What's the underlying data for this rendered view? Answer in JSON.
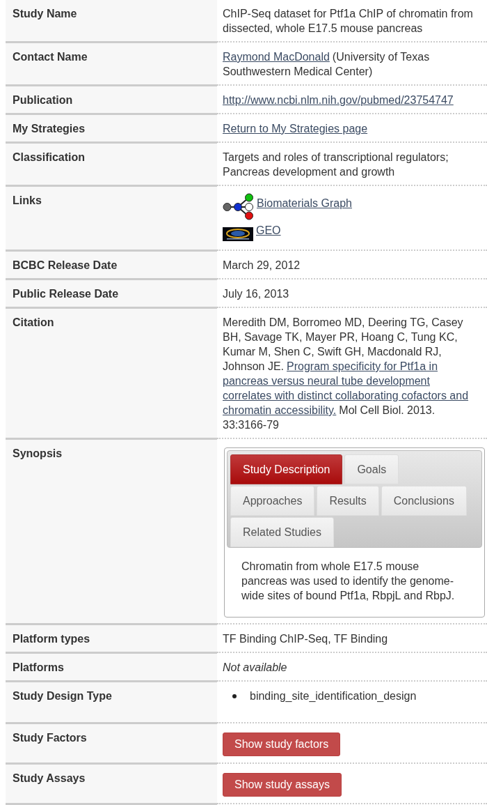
{
  "rows": [
    {
      "label": "Study Name",
      "kind": "text",
      "value": "ChIP-Seq dataset for Ptf1a ChIP of chromatin from dissected, whole E17.5 mouse pancreas"
    },
    {
      "label": "Contact Name",
      "kind": "lines",
      "lines": [
        [
          {
            "kind": "link",
            "text": "Raymond MacDonald"
          },
          {
            "kind": "text",
            "text": "(University of Texas"
          }
        ],
        [
          {
            "kind": "text",
            "text": "Southwestern Medical Center)"
          }
        ]
      ]
    },
    {
      "label": "Publication",
      "kind": "lines",
      "lines": [
        [
          {
            "kind": "link",
            "text": "http://www.ncbi.nlm.nih.gov/pubmed/23754747"
          }
        ]
      ]
    },
    {
      "label": "My Strategies",
      "kind": "lines",
      "lines": [
        [
          {
            "kind": "link",
            "text": "Return to My Strategies page"
          }
        ]
      ]
    },
    {
      "label": "Classification",
      "kind": "text",
      "value": "Targets and roles of transcriptional regulators; Pancreas development and growth"
    },
    {
      "label": "Links",
      "kind": "links",
      "links": [
        {
          "kind": "graph",
          "text": "Biomaterials Graph"
        },
        {
          "kind": "geo",
          "text": "GEO"
        }
      ]
    },
    {
      "label": "BCBC Release Date",
      "kind": "text",
      "value": "March 29, 2012"
    },
    {
      "label": "Public Release Date",
      "kind": "text",
      "value": "July 16, 2013"
    },
    {
      "label": "Citation",
      "kind": "lines",
      "lines": [
        [
          {
            "kind": "text",
            "text": "Meredith DM, Borromeo MD, Deering TG, Casey"
          }
        ],
        [
          {
            "kind": "text",
            "text": "BH, Savage TK, Mayer PR, Hoang C, Tung KC,"
          }
        ],
        [
          {
            "kind": "text",
            "text": "Kumar M, Shen C, Swift GH, Macdonald RJ,"
          }
        ],
        [
          {
            "kind": "text",
            "text": "Johnson JE."
          },
          {
            "kind": "link",
            "text": "Program specificity for Ptf1a in"
          }
        ],
        [
          {
            "kind": "link",
            "text": "pancreas versus neural tube development"
          }
        ],
        [
          {
            "kind": "link",
            "text": "correlates with distinct collaborating cofactors and"
          }
        ],
        [
          {
            "kind": "link",
            "text": "chromatin accessibility."
          },
          {
            "kind": "text",
            "text": "Mol Cell Biol. 2013."
          }
        ],
        [
          {
            "kind": "text",
            "text": "33:3166-79"
          }
        ]
      ]
    },
    {
      "label": "Synopsis",
      "kind": "tabs",
      "tabs": [
        {
          "label": "Study Description",
          "selected": true
        },
        {
          "label": "Goals",
          "selected": false
        },
        {
          "label": "Approaches",
          "selected": false
        },
        {
          "label": "Results",
          "selected": false
        },
        {
          "label": "Conclusions",
          "selected": false
        },
        {
          "label": "Related Studies",
          "selected": false
        }
      ],
      "body": "Chromatin from whole E17.5 mouse pancreas was used to identify the genome-wide sites of bound Ptf1a, RbpjL and RbpJ."
    },
    {
      "label": "Platform types",
      "kind": "text",
      "value": "TF Binding ChIP-Seq, TF Binding"
    },
    {
      "label": "Platforms",
      "kind": "text",
      "value": "Not available",
      "italic": true
    },
    {
      "label": "Study Design Type",
      "kind": "list",
      "items": [
        "binding_site_identification_design"
      ]
    },
    {
      "label": "Study Factors",
      "kind": "button",
      "button": "Show study factors"
    },
    {
      "label": "Study Assays",
      "kind": "button",
      "button": "Show study assays"
    }
  ]
}
